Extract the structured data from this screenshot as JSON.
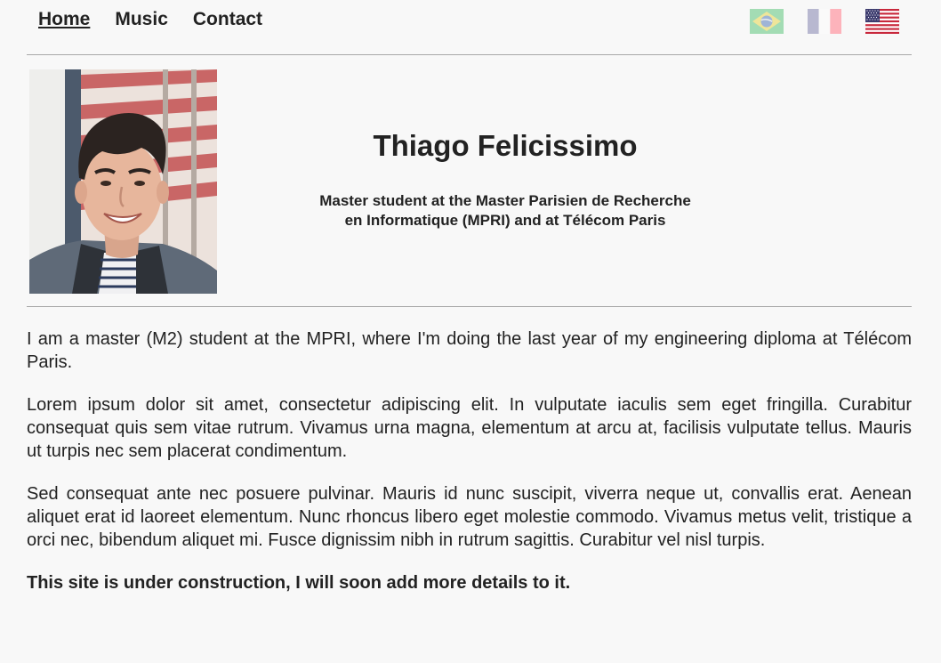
{
  "nav": {
    "items": [
      {
        "label": "Home"
      },
      {
        "label": "Music"
      },
      {
        "label": "Contact"
      }
    ]
  },
  "languages": [
    {
      "icon": "brazil-flag-icon"
    },
    {
      "icon": "france-flag-icon"
    },
    {
      "icon": "usa-flag-icon"
    }
  ],
  "header": {
    "name": "Thiago Felicissimo",
    "subtitle_line1": "Master student at the Master Parisien de Recherche",
    "subtitle_line2": "en Informatique (MPRI) and at Télécom Paris"
  },
  "content": {
    "paragraphs": [
      "I am a master (M2) student at the MPRI, where I'm doing the last year of my engineering diploma at Télécom Paris.",
      "Lorem ipsum dolor sit amet, consectetur adipiscing elit. In vulputate iaculis sem eget fringilla. Curabitur consequat quis sem vitae rutrum. Vivamus urna magna, elementum at arcu at, facilisis vulputate tellus. Mauris ut turpis nec sem placerat condimentum.",
      "Sed consequat ante nec posuere pulvinar. Mauris id nunc suscipit, viverra neque ut, convallis erat. Aenean aliquet erat id laoreet elementum. Nunc rhoncus libero eget molestie commodo. Vivamus metus velit, tristique a orci nec, bibendum aliquet mi. Fusce dignissim nibh in rutrum sagittis. Curabitur vel nisl turpis."
    ],
    "notice": "This site is under construction, I will soon add more details to it."
  },
  "colors": {
    "background": "#f8f8f8",
    "text": "#222222",
    "rule": "#a8a8a8"
  }
}
